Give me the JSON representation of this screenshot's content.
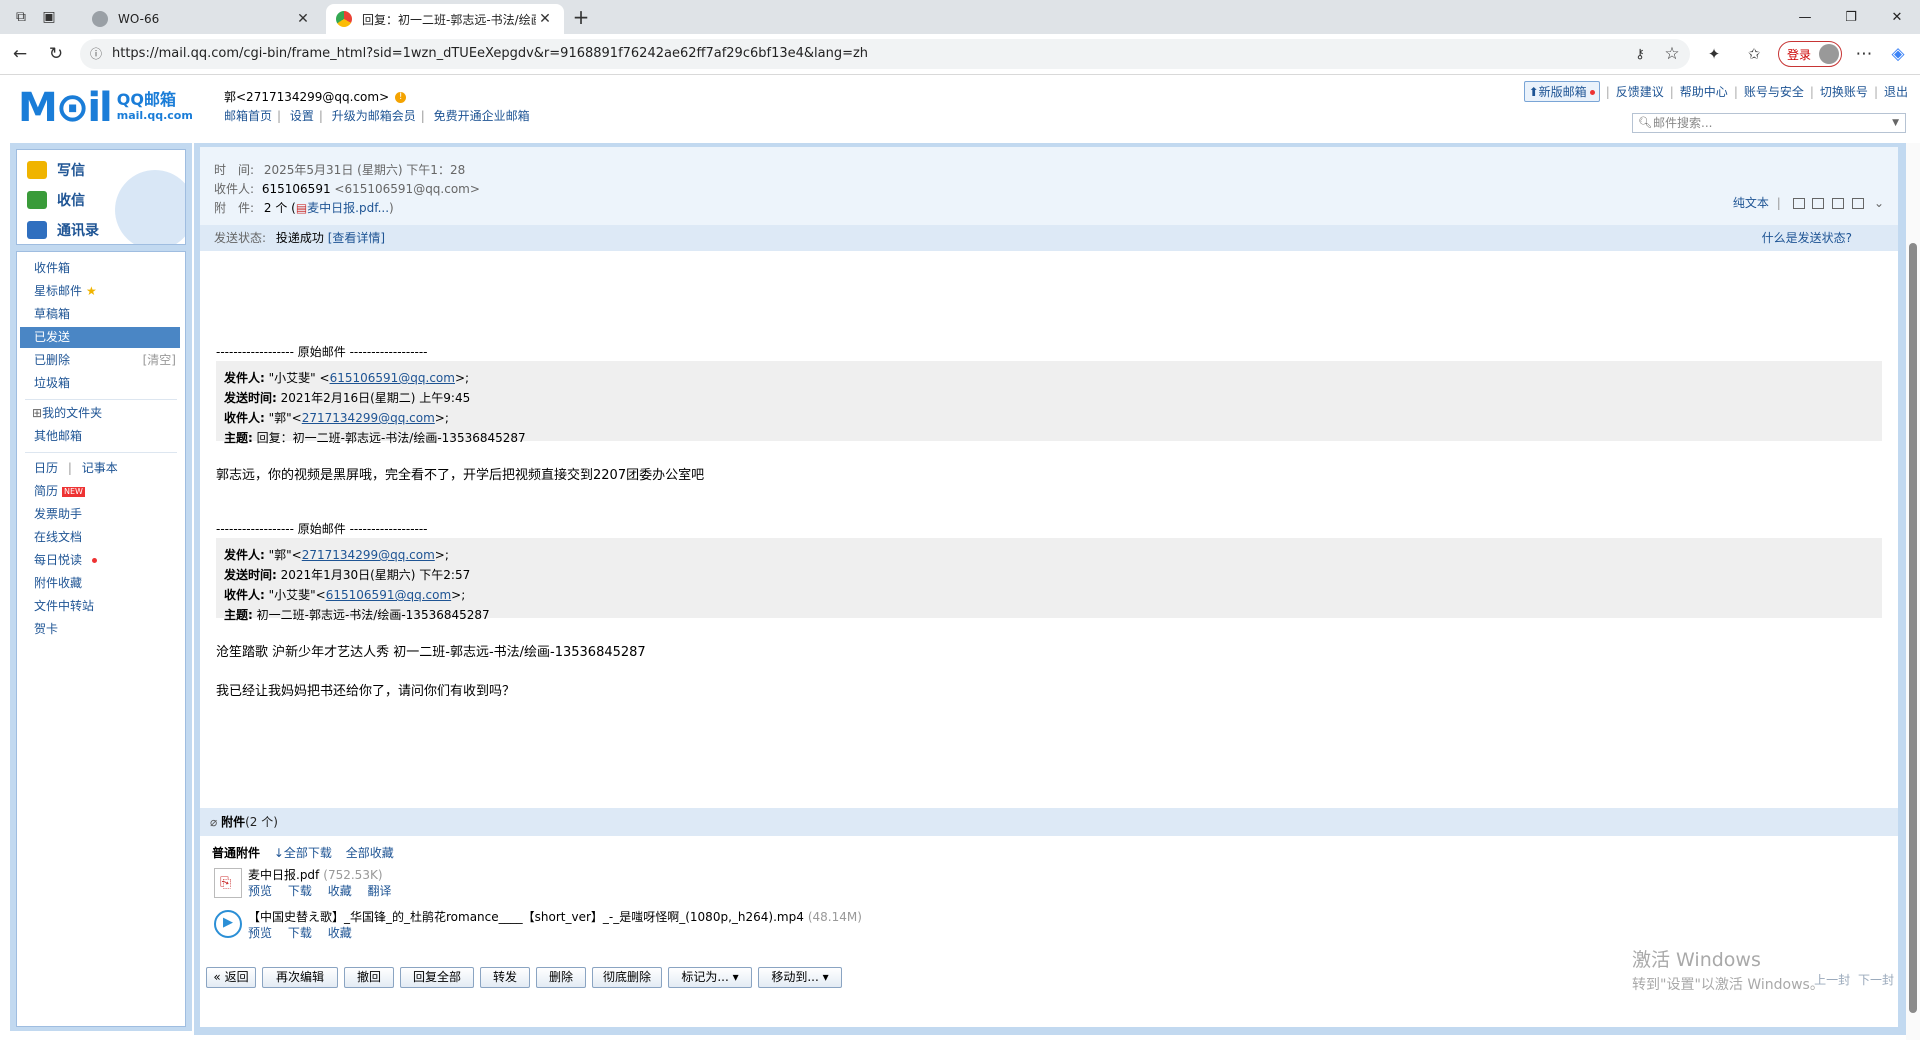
{
  "browser": {
    "tabs": [
      {
        "title": "WO-66",
        "close": "✕"
      },
      {
        "title": "回复：初一二班-郭志远-书法/绘画",
        "close": "✕"
      }
    ],
    "new_tab": "+",
    "url": "https://mail.qq.com/cgi-bin/frame_html?sid=1wzn_dTUEeXepgdv&r=9168891f76242ae62ff7af29c6bf13e4&lang=zh",
    "login_label": "登录",
    "window": {
      "min": "—",
      "restore": "❐",
      "close": "✕"
    }
  },
  "mail_header": {
    "logo_big": "M⊙il",
    "logo_name": "QQ邮箱",
    "logo_domain": "mail.qq.com",
    "account": "郭<2717134299@qq.com>",
    "account_links": [
      "邮箱首页",
      "设置",
      "升级为邮箱会员",
      "免费开通企业邮箱"
    ],
    "new_version": "新版邮箱",
    "top_links": [
      "反馈建议",
      "帮助中心",
      "账号与安全",
      "切换账号",
      "退出"
    ],
    "search_placeholder": "邮件搜索..."
  },
  "sidebar": {
    "compose": "写信",
    "inbox_btn": "收信",
    "contacts": "通讯录",
    "folders": [
      {
        "label": "收件箱"
      },
      {
        "label": "星标邮件"
      },
      {
        "label": "草稿箱"
      },
      {
        "label": "已发送"
      },
      {
        "label": "已删除",
        "aux": "[清空]"
      },
      {
        "label": "垃圾箱"
      }
    ],
    "my_folders": "我的文件夹",
    "other_mail": "其他邮箱",
    "calendar": "日历",
    "notes": "记事本",
    "apps": [
      {
        "label": "简历",
        "badge": "NEW"
      },
      {
        "label": "发票助手"
      },
      {
        "label": "在线文档"
      },
      {
        "label": "每日悦读"
      },
      {
        "label": "附件收藏"
      },
      {
        "label": "文件中转站"
      },
      {
        "label": "贺卡"
      }
    ]
  },
  "message": {
    "time_label": "时　间:",
    "time_value": "2025年5月31日 (星期六) 下午1：28",
    "to_label": "收件人:",
    "to_name": "615106591",
    "to_addr": "<615106591@qq.com>",
    "attach_label": "附　件:",
    "attach_count": "2 个 (",
    "attach_link": "麦中日报.pdf...",
    "attach_close": ")",
    "tools_plain": "纯文本",
    "send_status_label": "发送状态:",
    "send_status_value": "投递成功",
    "send_status_link": "[查看详情]",
    "what_status": "什么是发送状态?"
  },
  "body": {
    "orig_sep_1": "------------------ 原始邮件 ------------------",
    "quote1": {
      "from_label": "发件人:",
      "from_value_pre": "\"小艾斐\" <",
      "from_email": "615106591@qq.com",
      "from_value_post": ">;",
      "date_label": "发送时间:",
      "date_value": "2021年2月16日(星期二) 上午9:45",
      "to_label": "收件人:",
      "to_value_pre": "\"郭\"<",
      "to_email": "2717134299@qq.com",
      "to_value_post": ">;",
      "subject_label": "主题:",
      "subject_value": "回复：初一二班-郭志远-书法/绘画-13536845287"
    },
    "reply_text": "郭志远，你的视频是黑屏哦，完全看不了，开学后把视频直接交到2207团委办公室吧",
    "orig_sep_2": "------------------ 原始邮件 ------------------",
    "quote2": {
      "from_label": "发件人:",
      "from_value_pre": "\"郭\"<",
      "from_email": "2717134299@qq.com",
      "from_value_post": ">;",
      "date_label": "发送时间:",
      "date_value": "2021年1月30日(星期六) 下午2:57",
      "to_label": "收件人:",
      "to_value_pre": "\"小艾斐\"<",
      "to_email": "615106591@qq.com",
      "to_value_post": ">;",
      "subject_label": "主题:",
      "subject_value": "初一二班-郭志远-书法/绘画-13536845287"
    },
    "line1": "沧笙踏歌 沪新少年才艺达人秀 初一二班-郭志远-书法/绘画-13536845287",
    "line2": "我已经让我妈妈把书还给你了，请问你们有收到吗？"
  },
  "attachments": {
    "header": "附件",
    "header_count": "(2 个)",
    "type_label": "普通附件",
    "download_all": "全部下载",
    "collect_all": "全部收藏",
    "items": [
      {
        "name": "麦中日报.pdf",
        "size": "(752.53K)",
        "actions": [
          "预览",
          "下载",
          "收藏",
          "翻译"
        ]
      },
      {
        "name": "【中国史替え歌】_华国锋_的_杜鹃花romance____【short_ver】_-_是嗤呀怪啊_(1080p,_h264).mp4",
        "size": "(48.14M)",
        "actions": [
          "预览",
          "下载",
          "收藏"
        ]
      }
    ]
  },
  "toolbar": {
    "buttons": [
      "« 返回",
      "再次编辑",
      "撤回",
      "回复全部",
      "转发",
      "删除",
      "彻底删除",
      "标记为... ▾",
      "移动到... ▾"
    ],
    "prev": "上一封",
    "next": "下一封"
  },
  "watermark": {
    "line1": "激活 Windows",
    "line2": "转到\"设置\"以激活 Windows。"
  }
}
